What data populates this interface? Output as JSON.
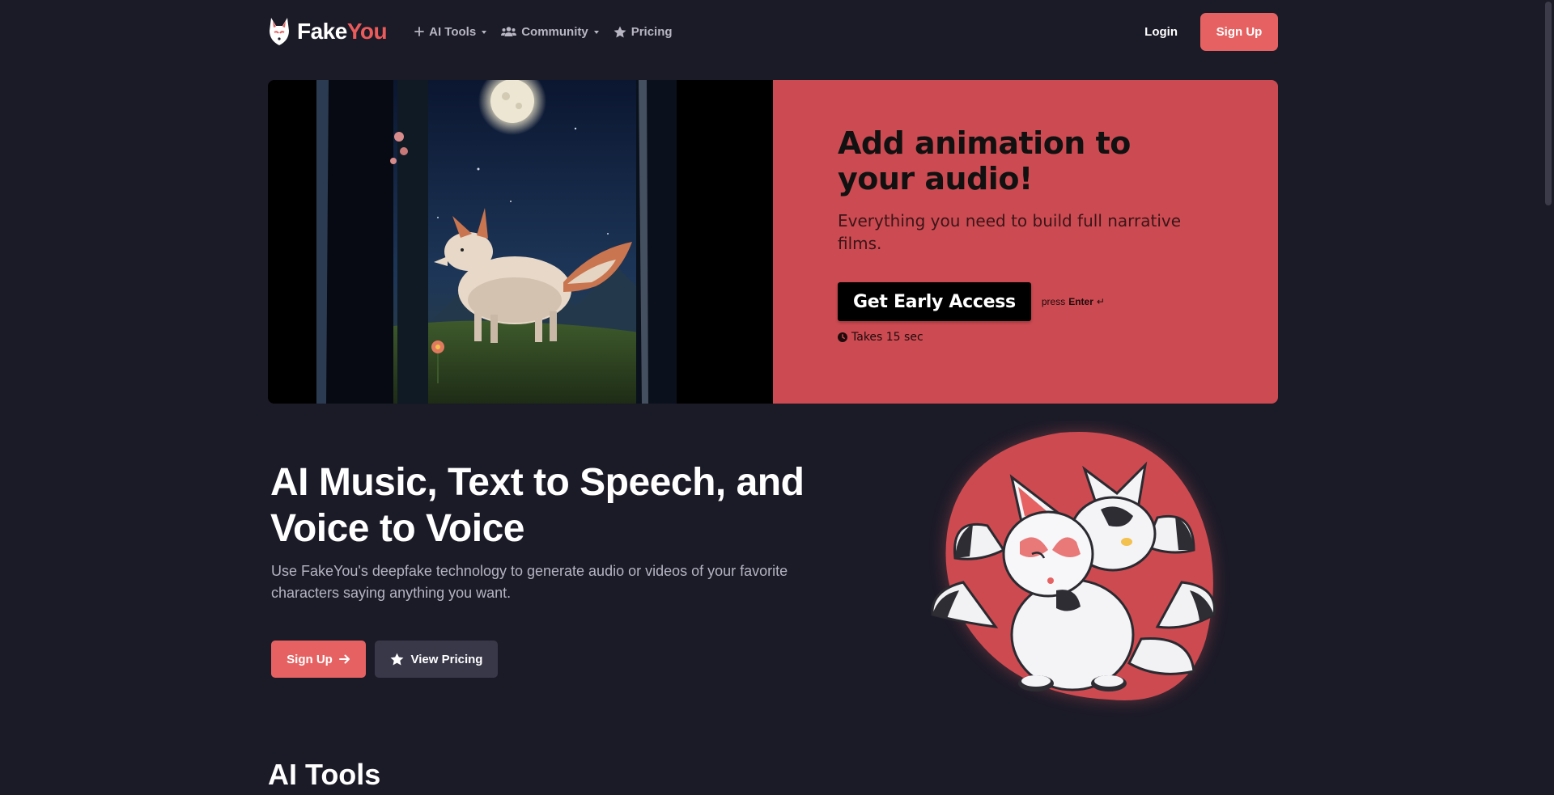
{
  "nav": {
    "brand_fake": "Fake",
    "brand_you": "You",
    "links": [
      {
        "label": "AI Tools",
        "icon": "plus-icon",
        "dropdown": true
      },
      {
        "label": "Community",
        "icon": "users-icon",
        "dropdown": true
      },
      {
        "label": "Pricing",
        "icon": "star-icon",
        "dropdown": false
      }
    ],
    "login_label": "Login",
    "signup_label": "Sign Up"
  },
  "promo": {
    "title": "Add animation to your audio!",
    "subtitle": "Everything you need to build full narrative films.",
    "cta_label": "Get Early Access",
    "press_label": "press",
    "press_key": "Enter",
    "enter_glyph": "↵",
    "takes_label": "Takes 15 sec"
  },
  "hero": {
    "title": "AI Music, Text to Speech, and Voice to Voice",
    "description": "Use FakeYou's deepfake technology to generate audio or videos of your favorite characters saying anything you want.",
    "signup_label": "Sign Up",
    "pricing_label": "View Pricing"
  },
  "next_section": {
    "heading": "AI Tools"
  },
  "colors": {
    "background": "#1b1a27",
    "accent": "#e66262",
    "promo_panel": "#cc4a51",
    "secondary_button": "#393849",
    "muted_text": "#b5b4c2"
  }
}
